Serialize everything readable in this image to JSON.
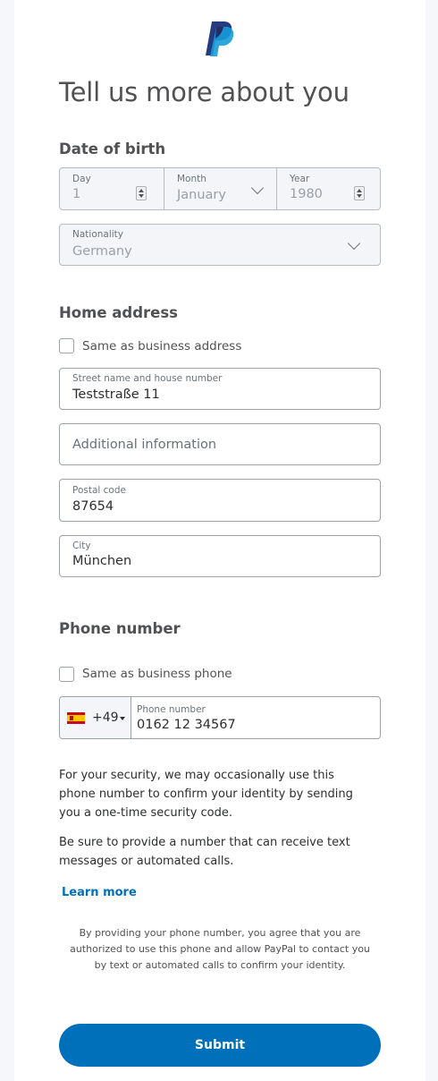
{
  "title": "Tell us more about you",
  "brand": {
    "logo_icon": "paypal-logo",
    "primary_color": "#0070ba",
    "dark_color": "#253b80"
  },
  "dob": {
    "heading": "Date of birth",
    "day": {
      "label": "Day",
      "value": "1"
    },
    "month": {
      "label": "Month",
      "value": "January"
    },
    "year": {
      "label": "Year",
      "value": "1980"
    }
  },
  "nationality": {
    "label": "Nationality",
    "value": "Germany"
  },
  "home": {
    "heading": "Home address",
    "same_as_business": {
      "label": "Same as business address",
      "checked": false
    },
    "street": {
      "label": "Street name and house number",
      "value": "Teststraße 11"
    },
    "additional": {
      "placeholder": "Additional information"
    },
    "postal": {
      "label": "Postal code",
      "value": "87654"
    },
    "city": {
      "label": "City",
      "value": "München"
    }
  },
  "phone": {
    "heading": "Phone number",
    "same_as_business": {
      "label": "Same as business phone",
      "checked": false
    },
    "country_code": "+49",
    "country_flag_icon": "spain-flag-icon",
    "number": {
      "label": "Phone number",
      "value": "0162 12 34567"
    }
  },
  "info": {
    "security": "For your security, we may occasionally use this phone number to confirm your identity by sending you a one-time security code.",
    "textable": "Be sure to provide a number that can receive text messages or automated calls.",
    "learn_more": "Learn more",
    "legal": "By providing your phone number, you agree that you are authorized to use this phone and allow PayPal to contact you by text or automated calls to confirm your identity."
  },
  "submit_label": "Submit"
}
